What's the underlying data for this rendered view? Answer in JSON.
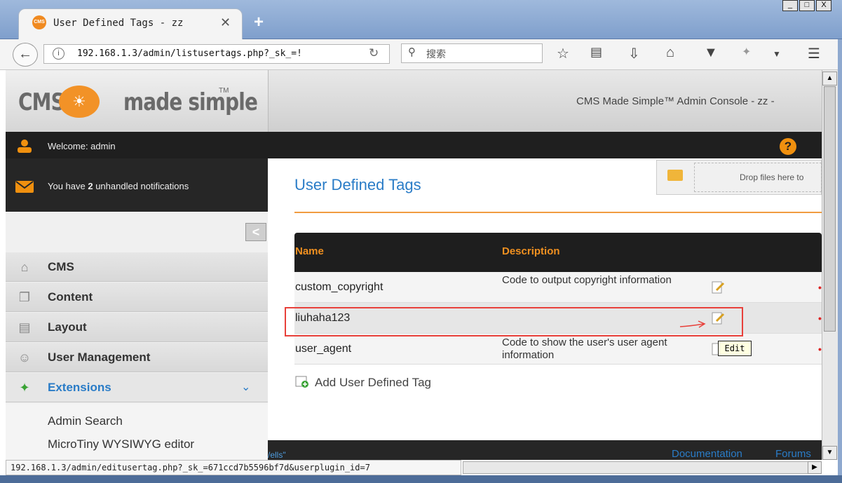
{
  "browser": {
    "tab_title": "User Defined Tags - zz",
    "tab_icon": "CMS",
    "tab_close": "✕",
    "new_tab": "+",
    "url": "192.168.1.3/admin/listusertags.php?_sk_=!",
    "search_placeholder": "搜索",
    "status_url": "192.168.1.3/admin/editusertag.php?_sk_=671ccd7b5596bf7d&userplugin_id=7",
    "window_buttons": [
      "_",
      "□",
      "X"
    ]
  },
  "header": {
    "logo_left": "CMS",
    "logo_right": "made simple",
    "logo_tm": "TM",
    "console_title": "CMS Made Simple™ Admin Console - zz -"
  },
  "welcome": {
    "text": "Welcome: admin",
    "help": "?"
  },
  "notifications": {
    "prefix": "You have ",
    "count": "2",
    "suffix": " unhandled notifications"
  },
  "sidebar": {
    "collapse": "<",
    "items": [
      {
        "label": "CMS"
      },
      {
        "label": "Content"
      },
      {
        "label": "Layout"
      },
      {
        "label": "User Management"
      },
      {
        "label": "Extensions"
      }
    ],
    "submenu": [
      "Admin Search",
      "MicroTiny WYSIWYG editor"
    ]
  },
  "main": {
    "title": "User Defined Tags",
    "drop_text": "Drop files here to",
    "table": {
      "headers": [
        "Name",
        "Description"
      ],
      "rows": [
        {
          "name": "custom_copyright",
          "description": "Code to output copyright information"
        },
        {
          "name": "liuhaha123",
          "description": ""
        },
        {
          "name": "user_agent",
          "description": "Code to show the user's user agent information"
        }
      ]
    },
    "tooltip": "Edit",
    "add_label": "Add User Defined Tag"
  },
  "footer": {
    "left_fragment": "/ells\"",
    "documentation": "Documentation",
    "forums": "Forums"
  },
  "colors": {
    "accent_orange": "#f09020",
    "link_blue": "#2a7cc7",
    "dark_bar": "#1f1f1f",
    "highlight_red": "#e8403a"
  }
}
